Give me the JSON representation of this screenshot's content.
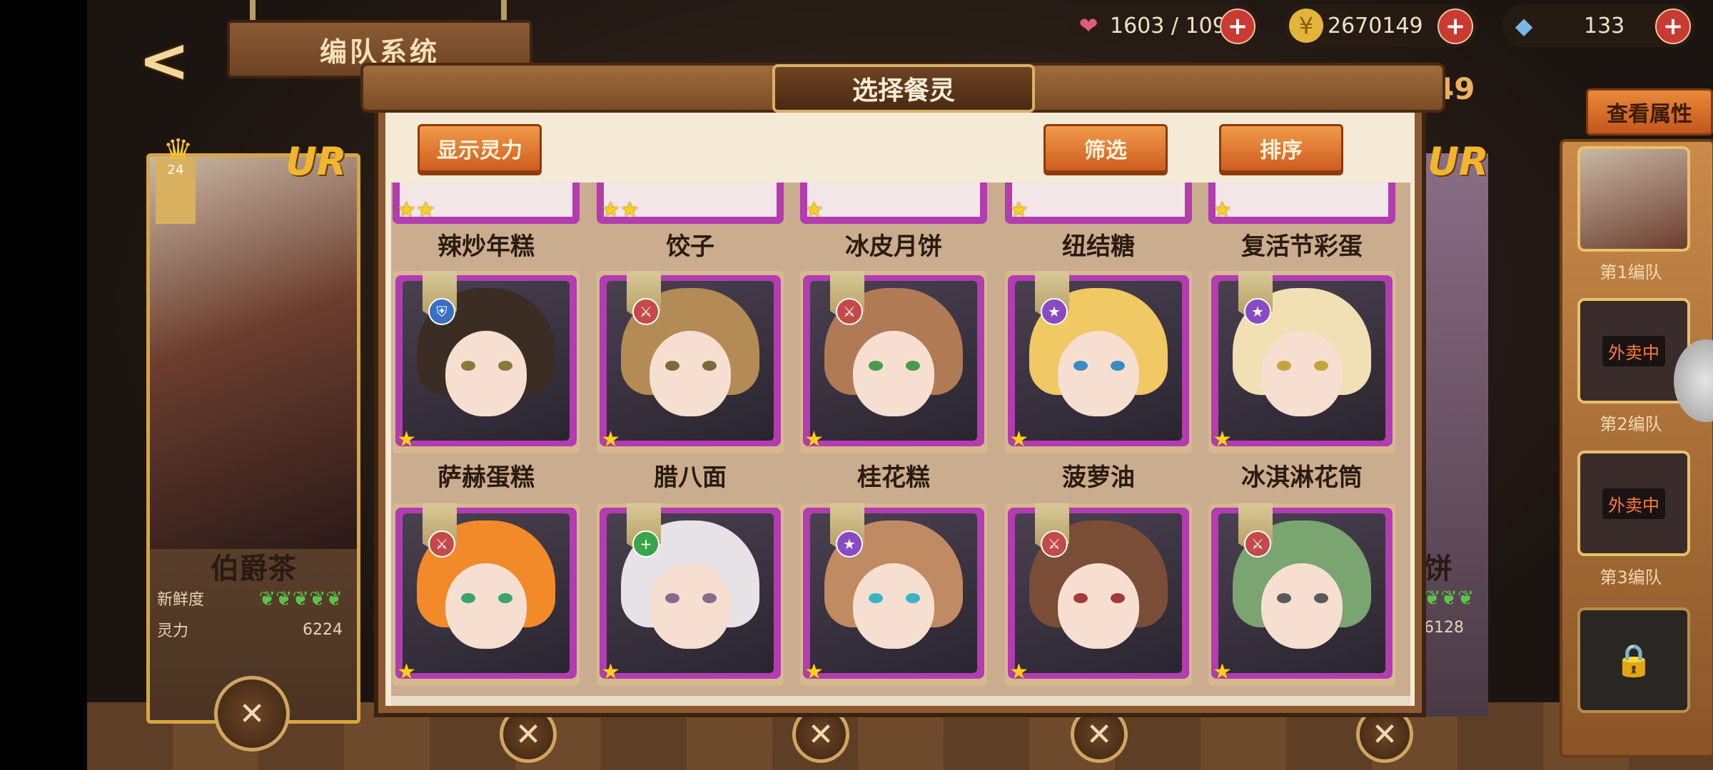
{
  "header": {
    "title": "编队系统",
    "back_icon": "back-arrow-icon"
  },
  "resources": [
    {
      "name": "stamina",
      "icon": "heart-icon",
      "value": "1603 / 109",
      "color": "#e05a7a"
    },
    {
      "name": "gold",
      "icon": "coin-icon",
      "value": "2670149",
      "color": "#e2b43a"
    },
    {
      "name": "crystal",
      "icon": "diamond-icon",
      "value": "133",
      "color": "#7ab6e8"
    }
  ],
  "left_card": {
    "rarity": "UR",
    "level": "24",
    "name": "伯爵茶",
    "fresh_label": "新鲜度",
    "power_label": "灵力",
    "power_value": "6224"
  },
  "right_card": {
    "rarity": "UR",
    "name_partial": "饼",
    "power_value": "6128",
    "top_number": "49"
  },
  "attr_button": "查看属性",
  "teams": [
    {
      "label": "第1编队",
      "status": ""
    },
    {
      "label": "第2编队",
      "status": "外卖中"
    },
    {
      "label": "第3编队",
      "status": "外卖中"
    }
  ],
  "dialog": {
    "title": "选择餐灵",
    "show_power_button": "显示灵力",
    "filter_button": "筛选",
    "sort_button": "排序"
  },
  "grid": {
    "top_row": [
      {
        "name": "辣炒年糕",
        "stars": 2
      },
      {
        "name": "饺子",
        "stars": 2
      },
      {
        "name": "冰皮月饼",
        "stars": 1
      },
      {
        "name": "纽结糖",
        "stars": 1
      },
      {
        "name": "复活节彩蛋",
        "stars": 1
      }
    ],
    "row2": [
      {
        "name": "萨赫蛋糕",
        "badge": "shield-icon",
        "badge_color": "#3a6fc4",
        "hair": "#3b2d24",
        "eye": "#8a7a3a"
      },
      {
        "name": "腊八面",
        "badge": "sword-icon",
        "badge_color": "#c44a4a",
        "hair": "#b48a55",
        "eye": "#7b6a3a"
      },
      {
        "name": "桂花糕",
        "badge": "sword-icon",
        "badge_color": "#c44a4a",
        "hair": "#b07a55",
        "eye": "#4a9a4a"
      },
      {
        "name": "菠萝油",
        "badge": "star-icon",
        "badge_color": "#8a4ac4",
        "hair": "#f0c864",
        "eye": "#3a8ac4"
      },
      {
        "name": "冰淇淋花筒",
        "badge": "star-icon",
        "badge_color": "#8a4ac4",
        "hair": "#f1e0b4",
        "eye": "#c4a43a"
      }
    ],
    "row3": [
      {
        "name": "",
        "badge": "sword-icon",
        "badge_color": "#c44a4a",
        "hair": "#f28a2a",
        "eye": "#3aa46a"
      },
      {
        "name": "",
        "badge": "plus-icon",
        "badge_color": "#3aa44a",
        "hair": "#e6e2e6",
        "eye": "#8a6a8a"
      },
      {
        "name": "",
        "badge": "star-icon",
        "badge_color": "#8a4ac4",
        "hair": "#c08a62",
        "eye": "#3ab4c4"
      },
      {
        "name": "",
        "badge": "sword-icon",
        "badge_color": "#c44a4a",
        "hair": "#7a4e36",
        "eye": "#a43a3a"
      },
      {
        "name": "",
        "badge": "sword-icon",
        "badge_color": "#c44a4a",
        "hair": "#7aa470",
        "eye": "#5a5a5a"
      }
    ]
  }
}
